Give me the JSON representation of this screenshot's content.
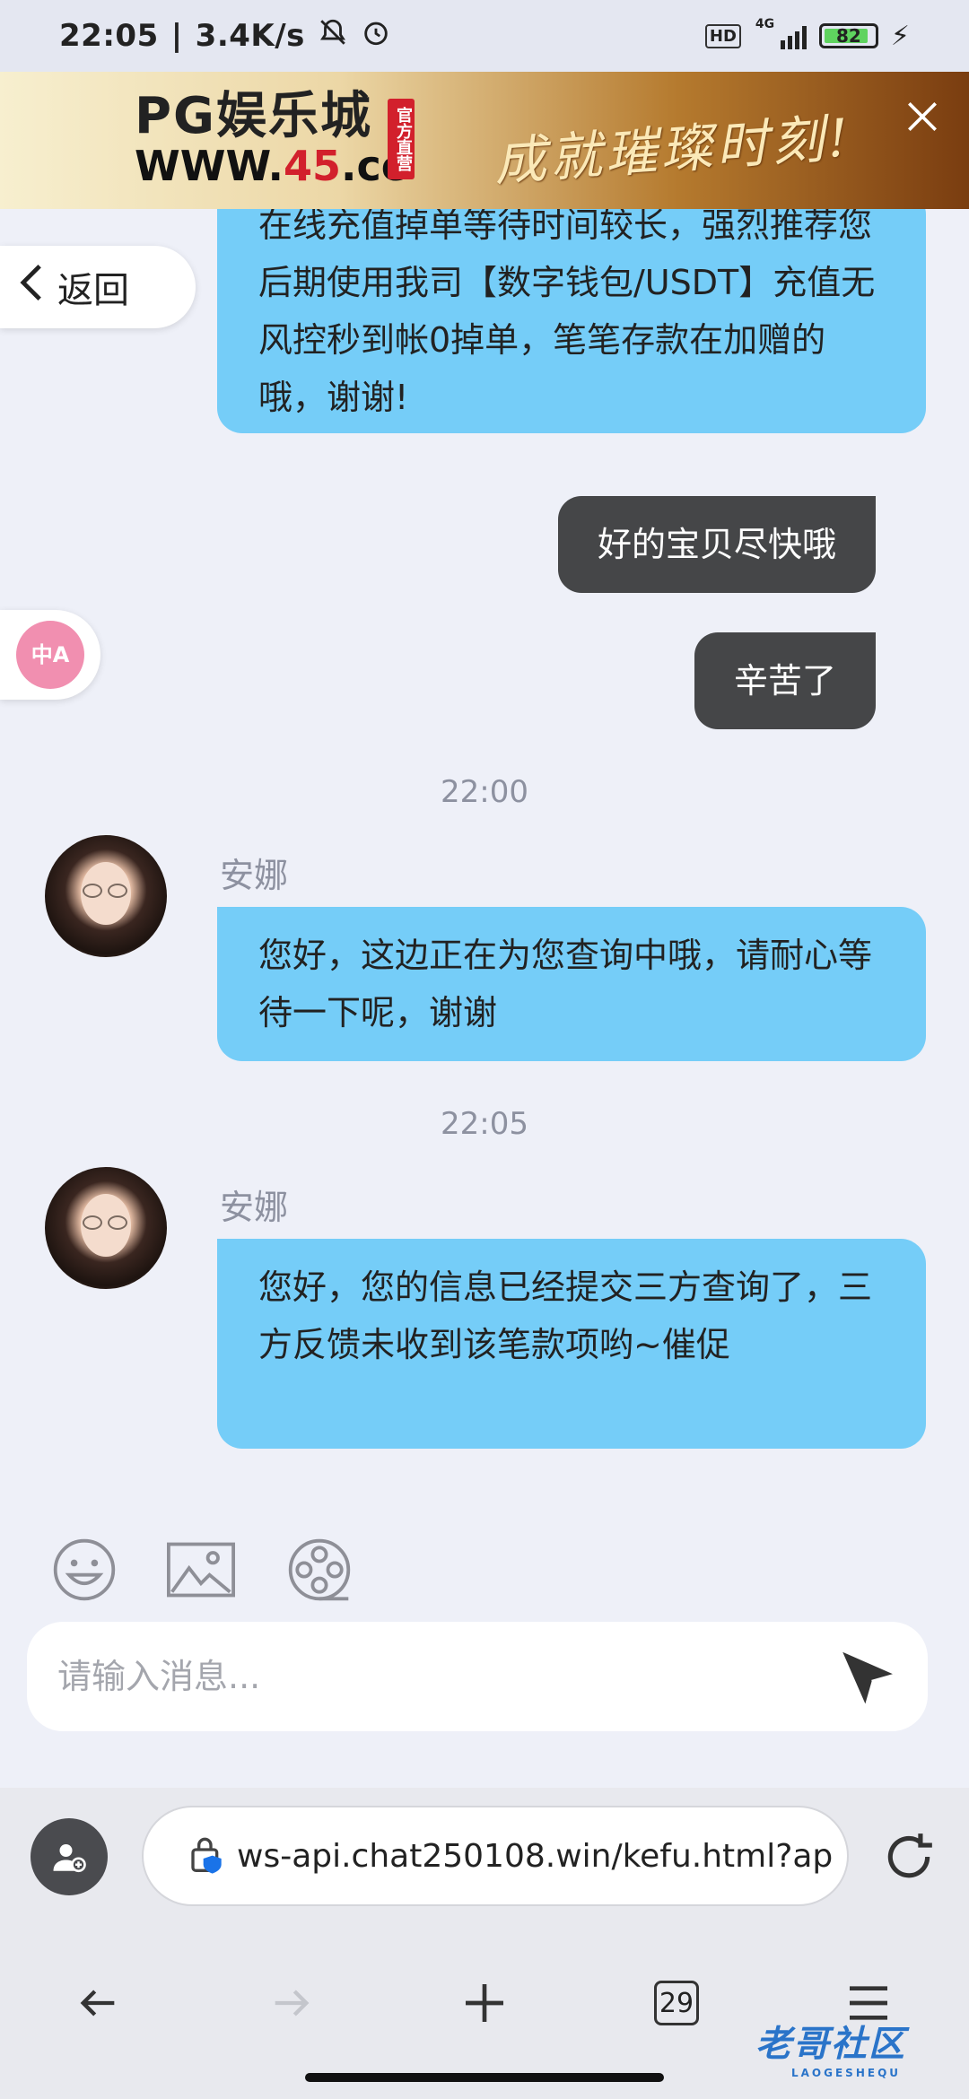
{
  "status_bar": {
    "time": "22:05",
    "net_speed": "3.4K/s",
    "network": "4G",
    "battery": "82"
  },
  "banner": {
    "logo_line1_pg": "PG",
    "logo_line1_name": "娱乐城",
    "logo_line2_pre": "WWW.",
    "logo_line2_num": "45",
    "logo_line2_post": ".cc",
    "badge": "官方直营",
    "slogan": "成就璀璨时刻!"
  },
  "nav": {
    "back_label": "返回"
  },
  "messages": {
    "m1_text": "在线充值掉单等待时间较长，强烈推荐您后期使用我司【数字钱包/USDT】充值无风控秒到帐0掉单，笔笔存款在加赠的哦，谢谢!",
    "m2_text": "好的宝贝尽快哦",
    "m3_text": "辛苦了",
    "t1": "22:00",
    "m4_sender": "安娜",
    "m4_text": "您好，这边正在为您查询中哦，请耐心等待一下呢，谢谢",
    "t2": "22:05",
    "m5_sender": "安娜",
    "m5_text": "您好，您的信息已经提交三方查询了，三方反馈未收到该笔款项哟~催促"
  },
  "composer": {
    "placeholder": "请输入消息..."
  },
  "browser": {
    "url": "ws-api.chat250108.win/kefu.html?ap",
    "tab_count": "29"
  },
  "watermark": {
    "text": "老哥社区",
    "sub": "LAOGESHEQU"
  }
}
